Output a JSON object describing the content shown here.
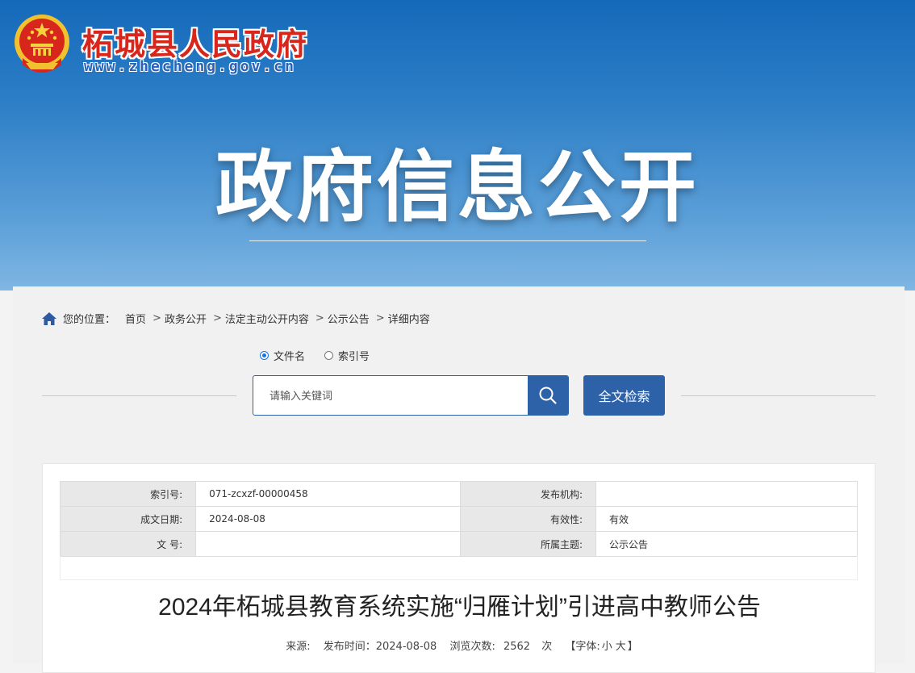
{
  "header": {
    "site_name": "柘城县人民政府",
    "site_url": "www.zhecheng.gov.cn",
    "banner_title": "政府信息公开"
  },
  "breadcrumb": {
    "prefix": "您的位置：",
    "items": [
      "首页",
      "政务公开",
      "法定主动公开内容",
      "公示公告",
      "详细内容"
    ],
    "separator": ">"
  },
  "search": {
    "options": [
      {
        "label": "文件名",
        "selected": true
      },
      {
        "label": "索引号",
        "selected": false
      }
    ],
    "placeholder": "请输入关键词",
    "fulltext_label": "全文检索"
  },
  "meta": {
    "rows": [
      {
        "k1": "索引号:",
        "v1": "071-zcxzf-00000458",
        "k2": "发布机构:",
        "v2": ""
      },
      {
        "k1": "成文日期:",
        "v1": "2024-08-08",
        "k2": "有效性:",
        "v2": "有效"
      },
      {
        "k1": "文 号:",
        "v1": "",
        "k2": "所属主题:",
        "v2": "公示公告"
      }
    ]
  },
  "article": {
    "title": "2024年柘城县教育系统实施“归雁计划”引进高中教师公告",
    "source_label": "来源:",
    "date_label": "发布时间：2024-08-08",
    "views_label": "浏览次数:",
    "views_count": "2562",
    "views_unit": "次",
    "font_label": "【字体:",
    "font_small": "小",
    "font_large": "大",
    "font_close": "】"
  },
  "colors": {
    "banner_top": "#1569b9",
    "banner_bottom": "#7fb6e3",
    "accent": "#2d62a8",
    "site_name_red": "#d7261c"
  }
}
